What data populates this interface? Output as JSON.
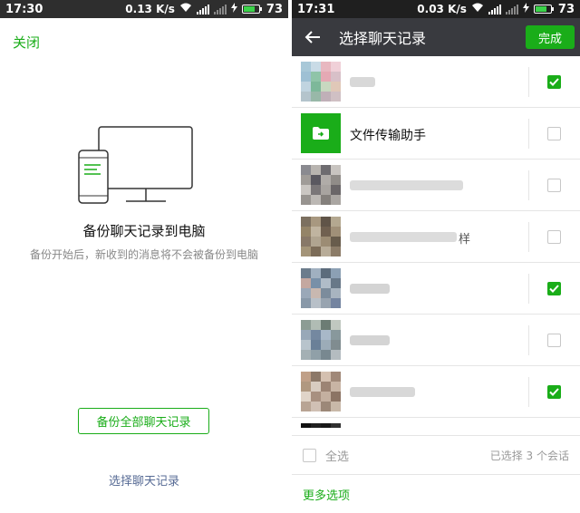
{
  "colors": {
    "accent": "#1aad19",
    "link": "#576b95",
    "header": "#393a3f"
  },
  "left": {
    "status": {
      "time": "17:30",
      "speed": "0.13 K/s",
      "battery": "73"
    },
    "close_label": "关闭",
    "title": "备份聊天记录到电脑",
    "description": "备份开始后，新收到的消息将不会被备份到电脑",
    "backup_all_label": "备份全部聊天记录",
    "select_label": "选择聊天记录"
  },
  "right": {
    "status": {
      "time": "17:31",
      "speed": "0.03 K/s",
      "battery": "73"
    },
    "title": "选择聊天记录",
    "done_label": "完成",
    "chats": [
      {
        "name": "",
        "checked": true,
        "avatar": "pixelated"
      },
      {
        "name": "文件传输助手",
        "checked": false,
        "avatar": "file-transfer-icon"
      },
      {
        "name": "",
        "checked": false,
        "avatar": "pixelated"
      },
      {
        "name": "",
        "name_suffix": "样",
        "checked": false,
        "avatar": "pixelated"
      },
      {
        "name": "",
        "checked": true,
        "avatar": "pixelated"
      },
      {
        "name": "",
        "checked": false,
        "avatar": "pixelated"
      },
      {
        "name": "",
        "checked": true,
        "avatar": "pixelated"
      },
      {
        "name": "",
        "checked": false,
        "avatar": "pixelated"
      }
    ],
    "select_all_label": "全选",
    "selected_count": "已选择 3 个会话",
    "more_options_label": "更多选项"
  }
}
